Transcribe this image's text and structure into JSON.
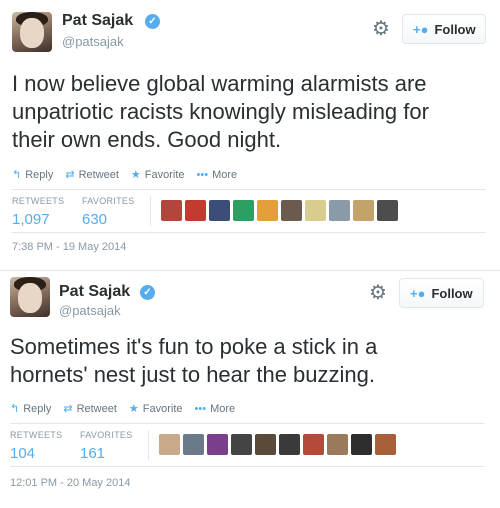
{
  "tweets": [
    {
      "user_name": "Pat Sajak",
      "handle": "@patsajak",
      "verified_mark": "✓",
      "follow_label": "Follow",
      "text_lines": [
        "I now believe global warming alarmists are",
        "unpatriotic racists knowingly misleading for",
        "their own ends. Good night."
      ],
      "actions": {
        "reply": "Reply",
        "retweet": "Retweet",
        "favorite": "Favorite",
        "more": "More"
      },
      "retweets_label": "RETWEETS",
      "retweets": "1,097",
      "favorites_label": "FAVORITES",
      "favorites": "630",
      "timestamp": "7:38 PM - 19 May 2014",
      "favoriter_avatar_colors": [
        "#b0473a",
        "#c23b2e",
        "#3b4e7a",
        "#2f9e63",
        "#e3a03a",
        "#6b5b4c",
        "#d9cc8f",
        "#8a9aa8",
        "#c2a36a",
        "#4d4d4d"
      ]
    },
    {
      "user_name": "Pat Sajak",
      "handle": "@patsajak",
      "verified_mark": "✓",
      "follow_label": "Follow",
      "text_lines": [
        "Sometimes it's fun to poke a stick in a",
        "hornets' nest just to hear the buzzing."
      ],
      "actions": {
        "reply": "Reply",
        "retweet": "Retweet",
        "favorite": "Favorite",
        "more": "More"
      },
      "retweets_label": "RETWEETS",
      "retweets": "104",
      "favorites_label": "FAVORITES",
      "favorites": "161",
      "timestamp": "12:01 PM - 20 May 2014",
      "favoriter_avatar_colors": [
        "#c8a98a",
        "#6a7a8a",
        "#7a3f8c",
        "#444444",
        "#5a4a3a",
        "#3a3a3a",
        "#b54a3a",
        "#9a7a5a",
        "#2e2e2e",
        "#a8603a"
      ]
    }
  ],
  "icons": {
    "gear": "⚙",
    "follow": "+👤",
    "reply": "↰",
    "retweet": "⇄",
    "favorite": "★",
    "more": "•••"
  },
  "colors": {
    "accent": "#55acee",
    "text": "#292f33",
    "muted": "#8899a6"
  }
}
